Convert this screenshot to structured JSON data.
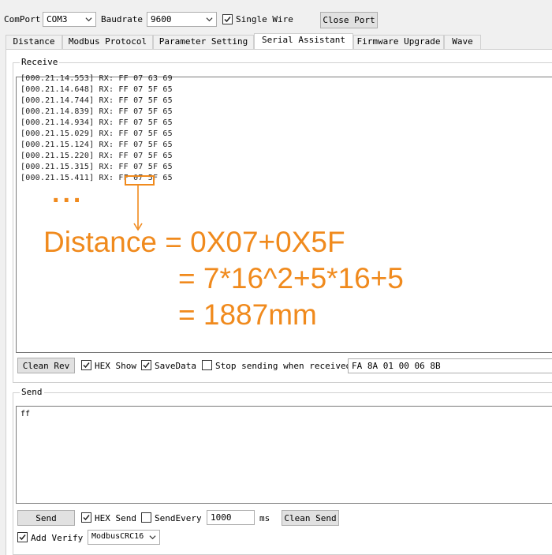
{
  "toolbar": {
    "comport_label": "ComPort",
    "comport_value": "COM3",
    "baudrate_label": "Baudrate",
    "baudrate_value": "9600",
    "single_wire_label": "Single Wire",
    "single_wire_checked": true,
    "close_port_label": "Close Port"
  },
  "tabs": [
    {
      "label": "Distance",
      "active": false
    },
    {
      "label": "Modbus Protocol",
      "active": false
    },
    {
      "label": "Parameter Setting",
      "active": false
    },
    {
      "label": "Serial Assistant",
      "active": true
    },
    {
      "label": "Firmware Upgrade",
      "active": false
    },
    {
      "label": "Wave",
      "active": false
    }
  ],
  "receive": {
    "group_label": "Receive",
    "lines": [
      "[000.21.14.553] RX: FF 07 63 69",
      "[000.21.14.648] RX: FF 07 5F 65",
      "[000.21.14.744] RX: FF 07 5F 65",
      "[000.21.14.839] RX: FF 07 5F 65",
      "[000.21.14.934] RX: FF 07 5F 65",
      "[000.21.15.029] RX: FF 07 5F 65",
      "[000.21.15.124] RX: FF 07 5F 65",
      "[000.21.15.220] RX: FF 07 5F 65",
      "[000.21.15.315] RX: FF 07 5F 65",
      "[000.21.15.411] RX: FF 07 5F 65"
    ],
    "clean_rev_label": "Clean Rev",
    "hex_show_label": "HEX Show",
    "hex_show_checked": true,
    "save_data_label": "SaveData",
    "save_data_checked": true,
    "stop_sending_label": "Stop sending when received",
    "stop_sending_checked": false,
    "stop_sending_value": "FA 8A 01 00 06 8B"
  },
  "annotation": {
    "ellipsis": "...",
    "line1": "Distance = 0X07+0X5F",
    "line2": "= 7*16^2+5*16+5",
    "line3": "= 1887mm",
    "color": "#f08a1d"
  },
  "send": {
    "group_label": "Send",
    "text": "ff",
    "send_label": "Send",
    "hex_send_label": "HEX Send",
    "hex_send_checked": true,
    "send_every_label": "SendEvery",
    "send_every_checked": false,
    "interval_value": "1000",
    "interval_unit": "ms",
    "clean_send_label": "Clean Send",
    "add_verify_label": "Add Verify",
    "add_verify_checked": true,
    "verify_method": "ModbusCRC16"
  }
}
